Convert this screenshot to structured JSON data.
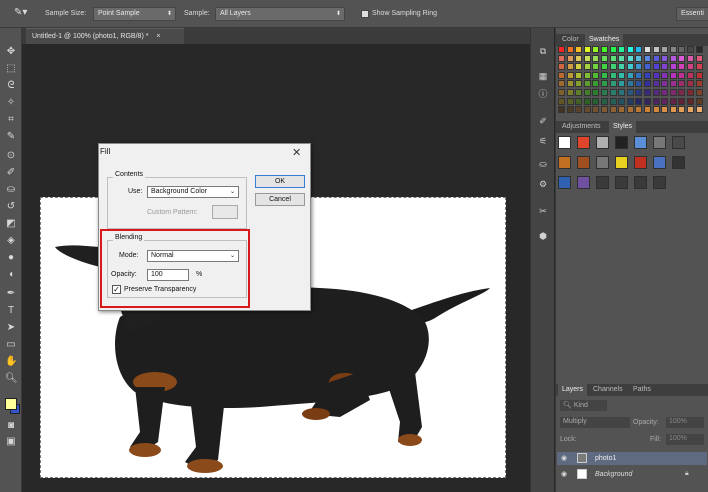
{
  "options_bar": {
    "sample_size_label": "Sample Size:",
    "sample_size_value": "Point Sample",
    "sample_label": "Sample:",
    "sample_value": "All Layers",
    "show_ring_label": "Show Sampling Ring",
    "workspace_label": "Essenti"
  },
  "document_tab": {
    "title": "Untitled-1 @ 100% (photo1, RGB/8) *",
    "close": "×"
  },
  "panels": {
    "color_tab": "Color",
    "swatches_tab": "Swatches",
    "adjustments_tab": "Adjustments",
    "styles_tab": "Styles",
    "layers_tab": "Layers",
    "channels_tab": "Channels",
    "paths_tab": "Paths"
  },
  "layers_panel": {
    "kind_label": "Kind",
    "blend_mode": "Multiply",
    "opacity_label": "Opacity:",
    "opacity_value": "100%",
    "lock_label": "Lock:",
    "fill_label": "Fill:",
    "fill_value": "100%",
    "layers": [
      {
        "name": "photo1"
      },
      {
        "name": "Background"
      }
    ]
  },
  "fill_dialog": {
    "title": "Fill",
    "contents_legend": "Contents",
    "use_label": "Use:",
    "use_value": "Background Color",
    "custom_pattern_label": "Custom Pattern:",
    "blending_legend": "Blending",
    "mode_label": "Mode:",
    "mode_value": "Normal",
    "opacity_label": "Opacity:",
    "opacity_value": "100",
    "opacity_unit": "%",
    "preserve_label": "Preserve Transparency",
    "ok_label": "OK",
    "cancel_label": "Cancel"
  },
  "colors": {
    "highlight_box": "#d7191c",
    "foreground_color": "#ffff99",
    "background_color": "#3355cc"
  }
}
